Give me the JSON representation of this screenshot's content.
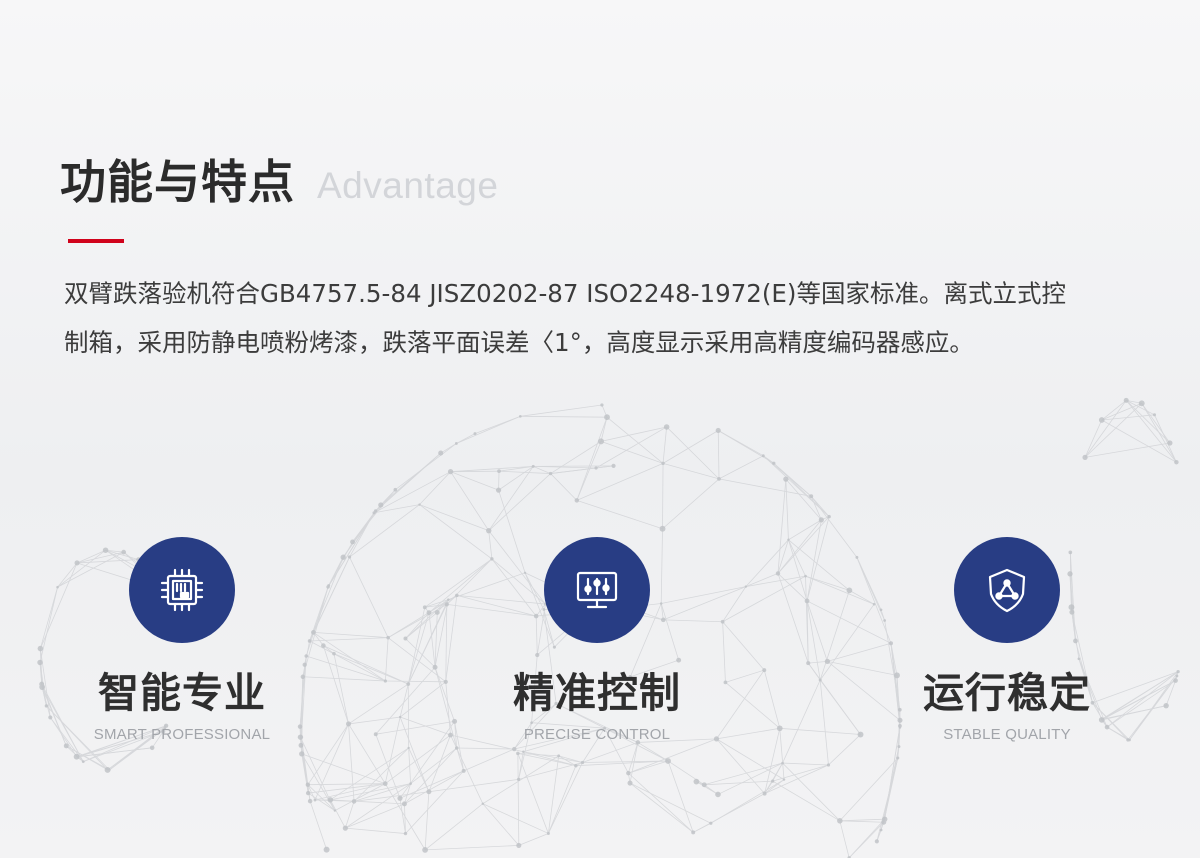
{
  "section": {
    "title": "功能与特点",
    "subtitle": "Advantage"
  },
  "description": "双臂跌落验机符合GB4757.5-84 JISZ0202-87 ISO2248-1972(E)等国家标准。离式立式控制箱，采用防静电喷粉烤漆，跌落平面误差〈1°，高度显示采用高精度编码器感应。",
  "features": [
    {
      "title": "智能专业",
      "subtitle": "SMART PROFESSIONAL",
      "icon": "chip-icon"
    },
    {
      "title": "精准控制",
      "subtitle": "PRECISE CONTROL",
      "icon": "control-panel-icon"
    },
    {
      "title": "运行稳定",
      "subtitle": "STABLE QUALITY",
      "icon": "shield-icon"
    }
  ],
  "colors": {
    "accent": "#d0021b",
    "icon_circle": "#283d84",
    "title_text": "#2b2b2b",
    "english_subtitle": "#d3d5d9"
  }
}
